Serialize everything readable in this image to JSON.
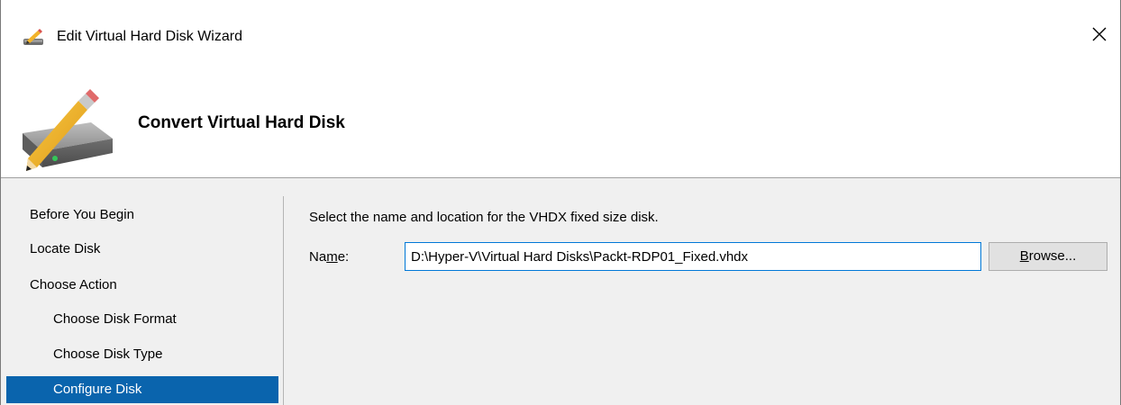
{
  "window": {
    "title": "Edit Virtual Hard Disk Wizard",
    "title_icon": "edit-disk-icon",
    "close_icon": "close-icon"
  },
  "header": {
    "title": "Convert Virtual Hard Disk",
    "icon": "hard-disk-pencil-icon"
  },
  "nav": {
    "items": [
      {
        "label": "Before You Begin",
        "level": 1,
        "selected": false
      },
      {
        "label": "Locate Disk",
        "level": 1,
        "selected": false
      },
      {
        "label": "Choose Action",
        "level": 1,
        "selected": false
      },
      {
        "label": "Choose Disk Format",
        "level": 2,
        "selected": false
      },
      {
        "label": "Choose Disk Type",
        "level": 2,
        "selected": false
      },
      {
        "label": "Configure Disk",
        "level": 2,
        "selected": true
      }
    ]
  },
  "main": {
    "instruction": "Select the name and location for the VHDX fixed size disk.",
    "name_label_pre": "Na",
    "name_label_accel": "m",
    "name_label_post": "e:",
    "name_value": "D:\\Hyper-V\\Virtual Hard Disks\\Packt-RDP01_Fixed.vhdx",
    "browse_accel": "B",
    "browse_rest": "rowse..."
  },
  "colors": {
    "selection": "#0a64ad",
    "input_focus_border": "#0078d7",
    "window_bg": "#f0f0f0"
  }
}
